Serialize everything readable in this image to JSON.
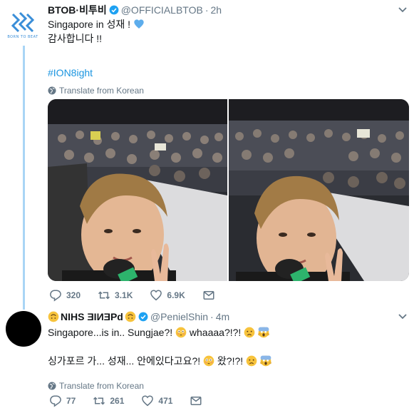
{
  "tweet1": {
    "name": "BTOB·비투비",
    "handle": "@OFFICIALBTOB",
    "separator": "·",
    "time": "2h",
    "line1": "Singapore in 성재 !",
    "line2": "감사합니다 !!",
    "hashtag": "#ION8ight",
    "translate": "Translate from Korean",
    "avatar_subtext": "BORN TO BEAT",
    "replies": "320",
    "retweets": "3.1K",
    "likes": "6.9K",
    "accent_color": "#1b95e0"
  },
  "tweet2": {
    "name_left": "NIHS ƎƎИI̲Ǝ",
    "name_display": "NIHS ƎIИƎPd",
    "handle": "@PenielShin",
    "separator": "·",
    "time": "4m",
    "line1": "Singapore...is in.. Sungjae?!",
    "line1_tail": "whaaaa?!?!",
    "line2": "싱가포르 가... 성재... 안에있다고요?!",
    "line2_tail": "왔?!?!",
    "translate": "Translate from Korean",
    "replies": "77",
    "retweets": "261",
    "likes": "471"
  }
}
